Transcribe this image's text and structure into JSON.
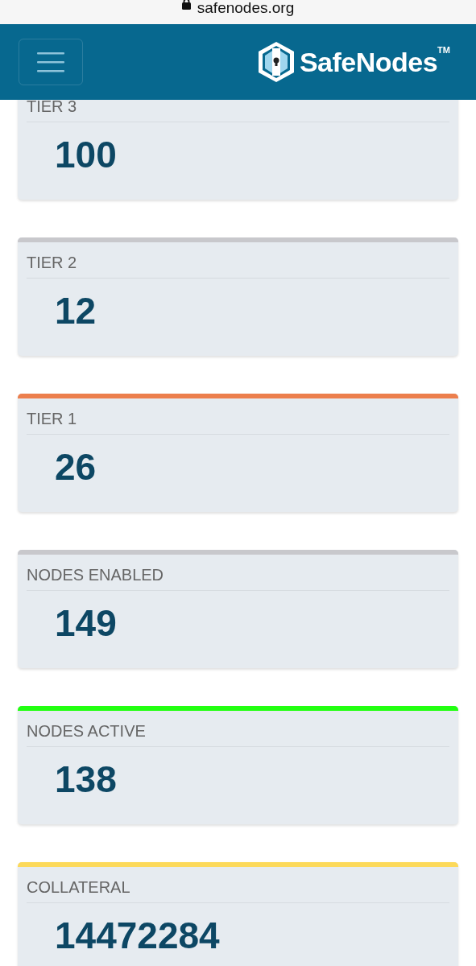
{
  "browser_bar": {
    "url": "safenodes.org"
  },
  "header": {
    "brand": "SafeNodes",
    "trademark": "TM"
  },
  "stats": [
    {
      "label": "TIER 3",
      "value": "100"
    },
    {
      "label": "TIER 2",
      "value": "12",
      "color": "#c8c8cc"
    },
    {
      "label": "TIER 1",
      "value": "26",
      "color": "#ec7f4d"
    },
    {
      "label": "NODES ENABLED",
      "value": "149",
      "color": "#c8c8cc"
    },
    {
      "label": "NODES ACTIVE",
      "value": "138",
      "color": "#22ff11"
    },
    {
      "label": "COLLATERAL",
      "value": "14472284",
      "color": "#fcd95a"
    }
  ]
}
